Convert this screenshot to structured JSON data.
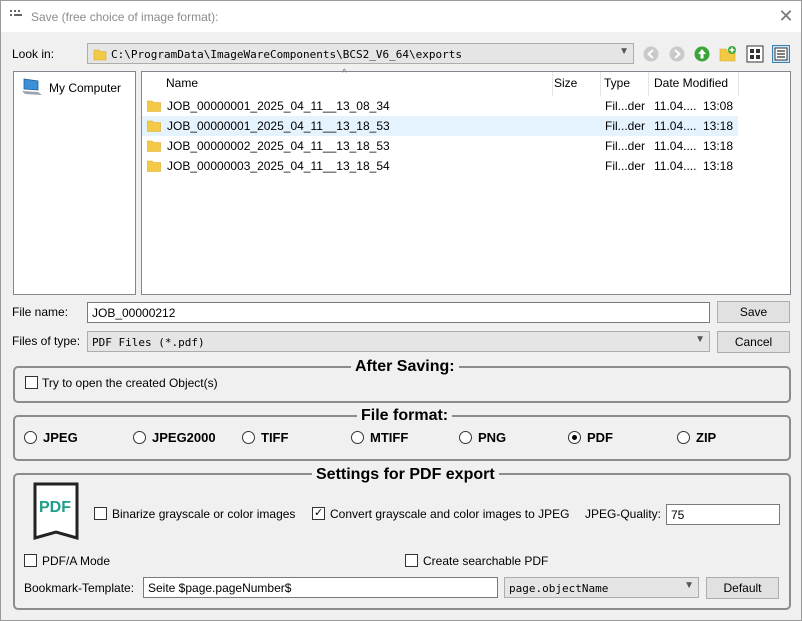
{
  "window": {
    "title": "Save (free choice of image format):"
  },
  "look_in": {
    "label": "Look in:",
    "path": "C:\\ProgramData\\ImageWareComponents\\BCS2_V6_64\\exports"
  },
  "places": [
    {
      "label": "My Computer",
      "icon": "computer-icon"
    }
  ],
  "file_list": {
    "columns": [
      "Name",
      "Size",
      "Type",
      "Date Modified"
    ],
    "rows": [
      {
        "name": "JOB_00000001_2025_04_11__13_08_34",
        "size": "",
        "type": "Fil...der",
        "date": "11.04....",
        "time": "13:08",
        "selected": false
      },
      {
        "name": "JOB_00000001_2025_04_11__13_18_53",
        "size": "",
        "type": "Fil...der",
        "date": "11.04....",
        "time": "13:18",
        "selected": true
      },
      {
        "name": "JOB_00000002_2025_04_11__13_18_53",
        "size": "",
        "type": "Fil...der",
        "date": "11.04....",
        "time": "13:18",
        "selected": false
      },
      {
        "name": "JOB_00000003_2025_04_11__13_18_54",
        "size": "",
        "type": "Fil...der",
        "date": "11.04....",
        "time": "13:18",
        "selected": false
      }
    ]
  },
  "file_name": {
    "label": "File name:",
    "value": "JOB_00000212"
  },
  "file_type": {
    "label": "Files of type:",
    "value": "PDF Files (*.pdf)"
  },
  "buttons": {
    "save": "Save",
    "cancel": "Cancel",
    "default": "Default"
  },
  "after_saving": {
    "title": "After Saving:",
    "open_created": {
      "label": "Try to open the created Object(s)",
      "checked": false
    }
  },
  "file_format": {
    "title": "File format:",
    "options": [
      "JPEG",
      "JPEG2000",
      "TIFF",
      "MTIFF",
      "PNG",
      "PDF",
      "ZIP"
    ],
    "selected": "PDF"
  },
  "pdf_settings": {
    "title": "Settings for PDF export",
    "icon_text": "PDF",
    "binarize": {
      "label": "Binarize grayscale or color images",
      "checked": false
    },
    "convert_jpeg": {
      "label": "Convert grayscale and color images to JPEG",
      "checked": true
    },
    "jpeg_quality_label": "JPEG-Quality:",
    "jpeg_quality_value": "75",
    "pdfa": {
      "label": "PDF/A Mode",
      "checked": false
    },
    "searchable": {
      "label": "Create searchable PDF",
      "checked": false
    },
    "bookmark_label": "Bookmark-Template:",
    "bookmark_value": "Seite $page.pageNumber$",
    "bookmark_field": "page.objectName"
  },
  "colors": {
    "accent_green": "#1e9e8a",
    "selection": "#e5f3ff",
    "folder": "#f3c945"
  }
}
